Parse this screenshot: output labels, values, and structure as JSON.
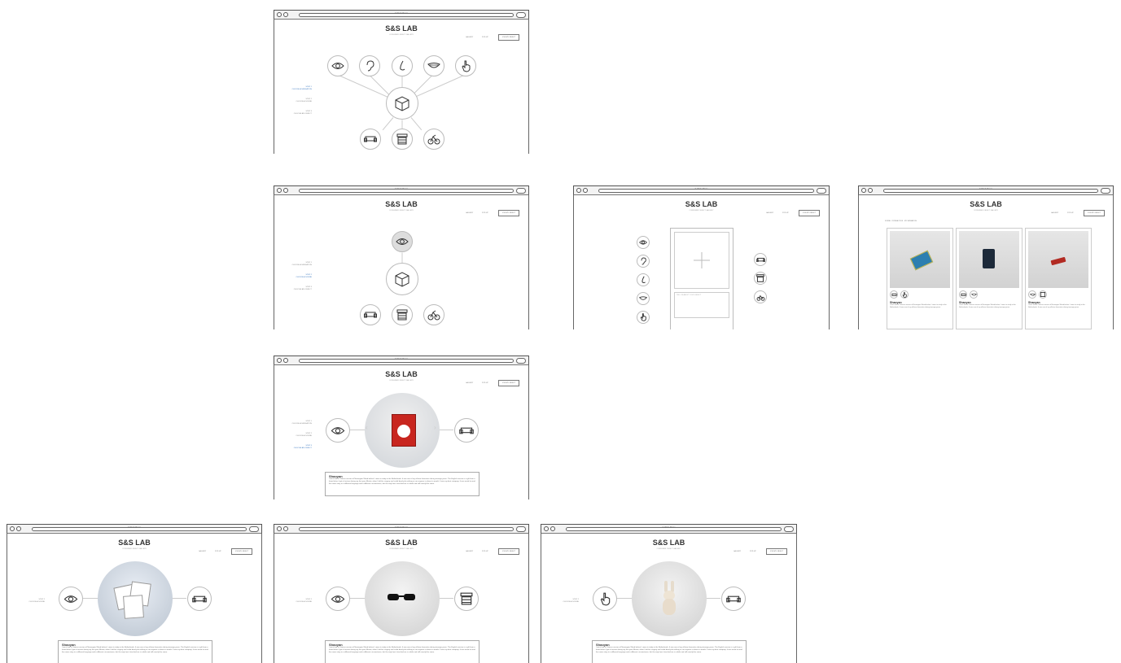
{
  "browser": {
    "tab_title": "A Web Page"
  },
  "site": {
    "brand": "S&S LAB",
    "tagline": "CONSUMER OBJECT GALLERY",
    "nav": [
      "GALLERY",
      "POP-UP"
    ],
    "join_label": "JOIN MY OBJECT"
  },
  "steps": [
    {
      "num": "STEP 1",
      "label": "CHOOSE A SENSATION"
    },
    {
      "num": "STEP 2",
      "label": "CHOOSE A SCENE"
    },
    {
      "num": "STEP 3",
      "label": "CHOOSE AN OBJECT"
    }
  ],
  "upload": {
    "caption_placeholder": "TELL US ABOUT YOUR OBJECT"
  },
  "gallery": {
    "breadcrumb": "SCENE · INTERACTION · MY SENSATION",
    "cards": [
      {
        "name": "Shaoyan",
        "text": "I once had a Chinese version of Norwegian Wood before I came to study in the Netherlands. It was one of my all-time favourites during teenage years."
      },
      {
        "name": "Shaoyan",
        "text": "I once had a Chinese version of Norwegian Wood before I came to study in the Netherlands. It was one of my all-time favourites during teenage years."
      },
      {
        "name": "Shaoyan",
        "text": "I once had a Chinese version of Norwegian Wood before I came to study in the Netherlands. It was one of my all-time favourites during teenage years."
      }
    ]
  },
  "story": {
    "name": "Shaoyan",
    "text": "I once had a Chinese version of Norwegian Wood before I came to study in the Netherlands. It was one of my all-time favourites during teenage years. The English version is a gift from a friend when I got a fracture during my first year Master, when I did the surgery and could barely do nothing or see anyone in almost a month. It was my best company. It was weird to read the same story in a different language and a different circumstance, but the way how it touched me is subtle and still exactly the same."
  },
  "colors": {
    "accent": "#3a78c0",
    "border": "#555555",
    "circle": "#bbbbbb"
  },
  "icons": {
    "senses": [
      "eye-icon",
      "ear-icon",
      "nose-icon",
      "mouth-icon",
      "hand-icon"
    ],
    "scenes": [
      "sofa-icon",
      "store-icon",
      "bike-icon"
    ],
    "center": "box-icon",
    "add": "plus-icon"
  }
}
